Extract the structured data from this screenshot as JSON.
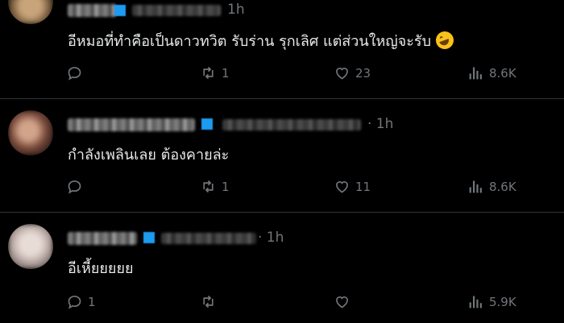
{
  "tweets": [
    {
      "time": "1h",
      "text": "อีหมอที่ทำคือเป็นดาวทวิต รับร่าน รุกเลิศ แต่ส่วนใหญ่จะรับ",
      "reply_count": "",
      "retweet_count": "1",
      "like_count": "23",
      "view_count": "8.6K",
      "emoji": "rolling-on-floor-laughing"
    },
    {
      "time": "· 1h",
      "text": "กำลังเพลินเลย ต้องคายล่ะ",
      "reply_count": "",
      "retweet_count": "1",
      "like_count": "11",
      "view_count": "8.6K"
    },
    {
      "time": "· 1h",
      "text": "อีเหี้ยยยยย",
      "reply_count": "1",
      "retweet_count": "",
      "like_count": "",
      "view_count": "5.9K"
    }
  ],
  "icons": {
    "reply": "reply-icon",
    "retweet": "retweet-icon",
    "like": "heart-icon",
    "views": "views-icon"
  },
  "colors": {
    "background": "#000000",
    "text": "#e7e9ea",
    "muted": "#71767b",
    "verified": "#1d9bf0",
    "divider": "#2f3336"
  }
}
